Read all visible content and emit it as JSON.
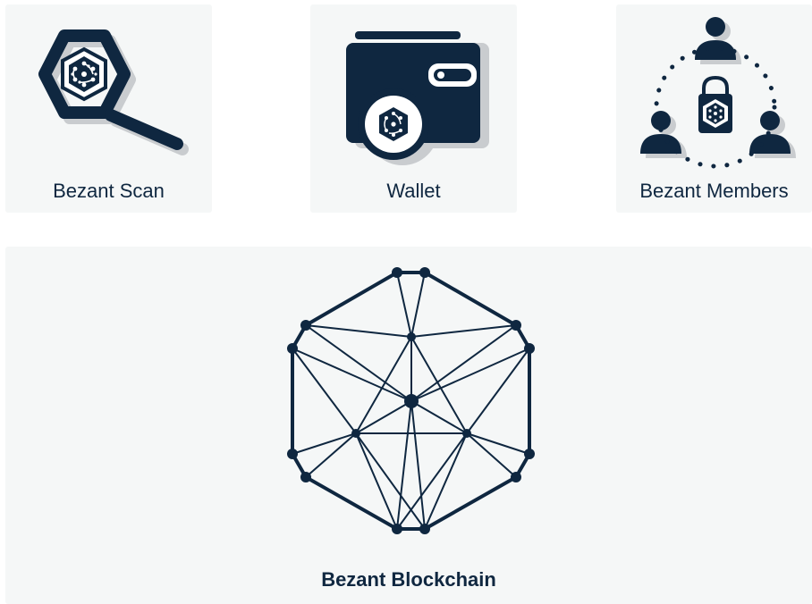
{
  "cards": [
    {
      "label": "Bezant Scan",
      "icon": "magnifier-icon"
    },
    {
      "label": "Wallet",
      "icon": "wallet-icon"
    },
    {
      "label": "Bezant Members",
      "icon": "members-icon"
    }
  ],
  "main": {
    "label": "Bezant Blockchain",
    "icon": "blockchain-hexagon-icon"
  },
  "colors": {
    "icon": "#0f2740",
    "card_bg": "#f5f7f7",
    "shadow": "#c9cccf",
    "accent_dots": "#0f2740"
  }
}
